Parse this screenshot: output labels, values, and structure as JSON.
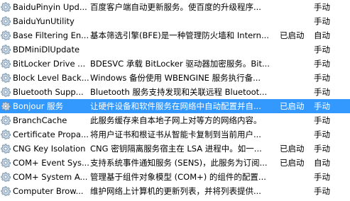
{
  "services": [
    {
      "name": "BaiduPinyin Upd...",
      "desc": "百度客户端自动更新服务。使百度的升级程序...",
      "status": "",
      "startup": "手动"
    },
    {
      "name": "BaiduYunUtility",
      "desc": "",
      "status": "",
      "startup": "手动"
    },
    {
      "name": "Base Filtering En...",
      "desc": "基本筛选引擎(BFE)是一种管理防火墙和 Intern...",
      "status": "已启动",
      "startup": "自动"
    },
    {
      "name": "BDMiniDlUpdate",
      "desc": "",
      "status": "",
      "startup": "手动"
    },
    {
      "name": "BitLocker Drive ...",
      "desc": "BDESVC 承载 BitLocker 驱动器加密服务。Bit...",
      "status": "",
      "startup": "手动"
    },
    {
      "name": "Block Level Back...",
      "desc": "Windows 备份使用 WBENGINE 服务执行备...",
      "status": "",
      "startup": "手动"
    },
    {
      "name": "Bluetooth Supp...",
      "desc": "Bluetooth 服务支持发现和关联远程 Bluetoot...",
      "status": "",
      "startup": "手动"
    },
    {
      "name": "Bonjour 服务",
      "desc": "让硬件设备和软件服务在网络中自动配置并自...",
      "status": "已启动",
      "startup": "手动",
      "selected": true
    },
    {
      "name": "BranchCache",
      "desc": "此服务缓存来自本地子网上对等方的网络内容。",
      "status": "",
      "startup": "手动"
    },
    {
      "name": "Certificate Propa...",
      "desc": "将用户证书和根证书从智能卡复制到当前用户...",
      "status": "",
      "startup": "手动"
    },
    {
      "name": "CNG Key Isolation",
      "desc": "CNG 密钥隔离服务宿主在 LSA 进程中。如一...",
      "status": "已启动",
      "startup": "手动"
    },
    {
      "name": "COM+ Event Sys...",
      "desc": "支持系统事件通知服务 (SENS)，此服务为订阅...",
      "status": "已启动",
      "startup": "自动"
    },
    {
      "name": "COM+ System A...",
      "desc": "管理基于组件对象模型 (COM+) 的组件的配置...",
      "status": "",
      "startup": "手动"
    },
    {
      "name": "Computer Brow...",
      "desc": "维护网络上计算机的更新列表，并将列表提供...",
      "status": "",
      "startup": "手动"
    }
  ],
  "colors": {
    "selection": "#3399ff",
    "gear_light": "#c6d4e2",
    "gear_dark": "#6f8aa4"
  },
  "icon_name": "gear-icon"
}
